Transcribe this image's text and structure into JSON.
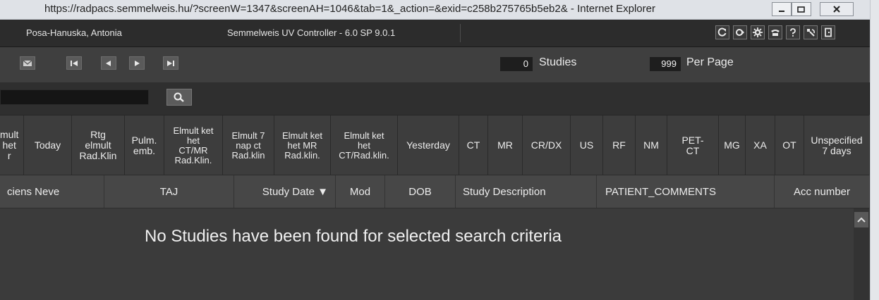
{
  "browser": {
    "title": "https://radpacs.semmelweis.hu/?screenW=1347&screenAH=1046&tab=1&_action=&exid=c258b275765b5eb2& - Internet Explorer"
  },
  "header": {
    "patient_name": "Posa-Hanuska, Antonia",
    "app_title": "Semmelweis UV Controller - 6.0 SP 9.0.1",
    "icons": [
      "refresh-icon",
      "forward-icon",
      "settings-icon",
      "phone-icon",
      "help-icon",
      "tools-icon",
      "logout-icon"
    ]
  },
  "toolbar": {
    "studies_count": "0",
    "studies_label": "Studies",
    "per_page_count": "999",
    "per_page_label": "Per Page"
  },
  "search": {
    "value": ""
  },
  "filters": [
    "mult\nhet\nr",
    "Today",
    "Rtg\nelmult\nRad.Klin",
    "Pulm.\nemb.",
    "Elmult ket\nhet\nCT/MR\nRad.Klin.",
    "Elmult 7\nnap ct\nRad.klin",
    "Elmult ket\nhet MR\nRad.klin.",
    "Elmult ket\nhet\nCT/Rad.klin.",
    "Yesterday",
    "CT",
    "MR",
    "CR/DX",
    "US",
    "RF",
    "NM",
    "PET-\nCT",
    "MG",
    "XA",
    "OT",
    "Unspecified\n7 days"
  ],
  "columns": [
    "ciens Neve",
    "TAJ",
    "Study Date ▼",
    "Mod",
    "DOB",
    "Study Description",
    "PATIENT_COMMENTS",
    "Acc number"
  ],
  "results": {
    "empty_message": "No Studies have been found for selected search criteria"
  },
  "colors": {
    "panel": "#3d3d3d",
    "header": "#2c2c2c",
    "text": "#ececec"
  }
}
